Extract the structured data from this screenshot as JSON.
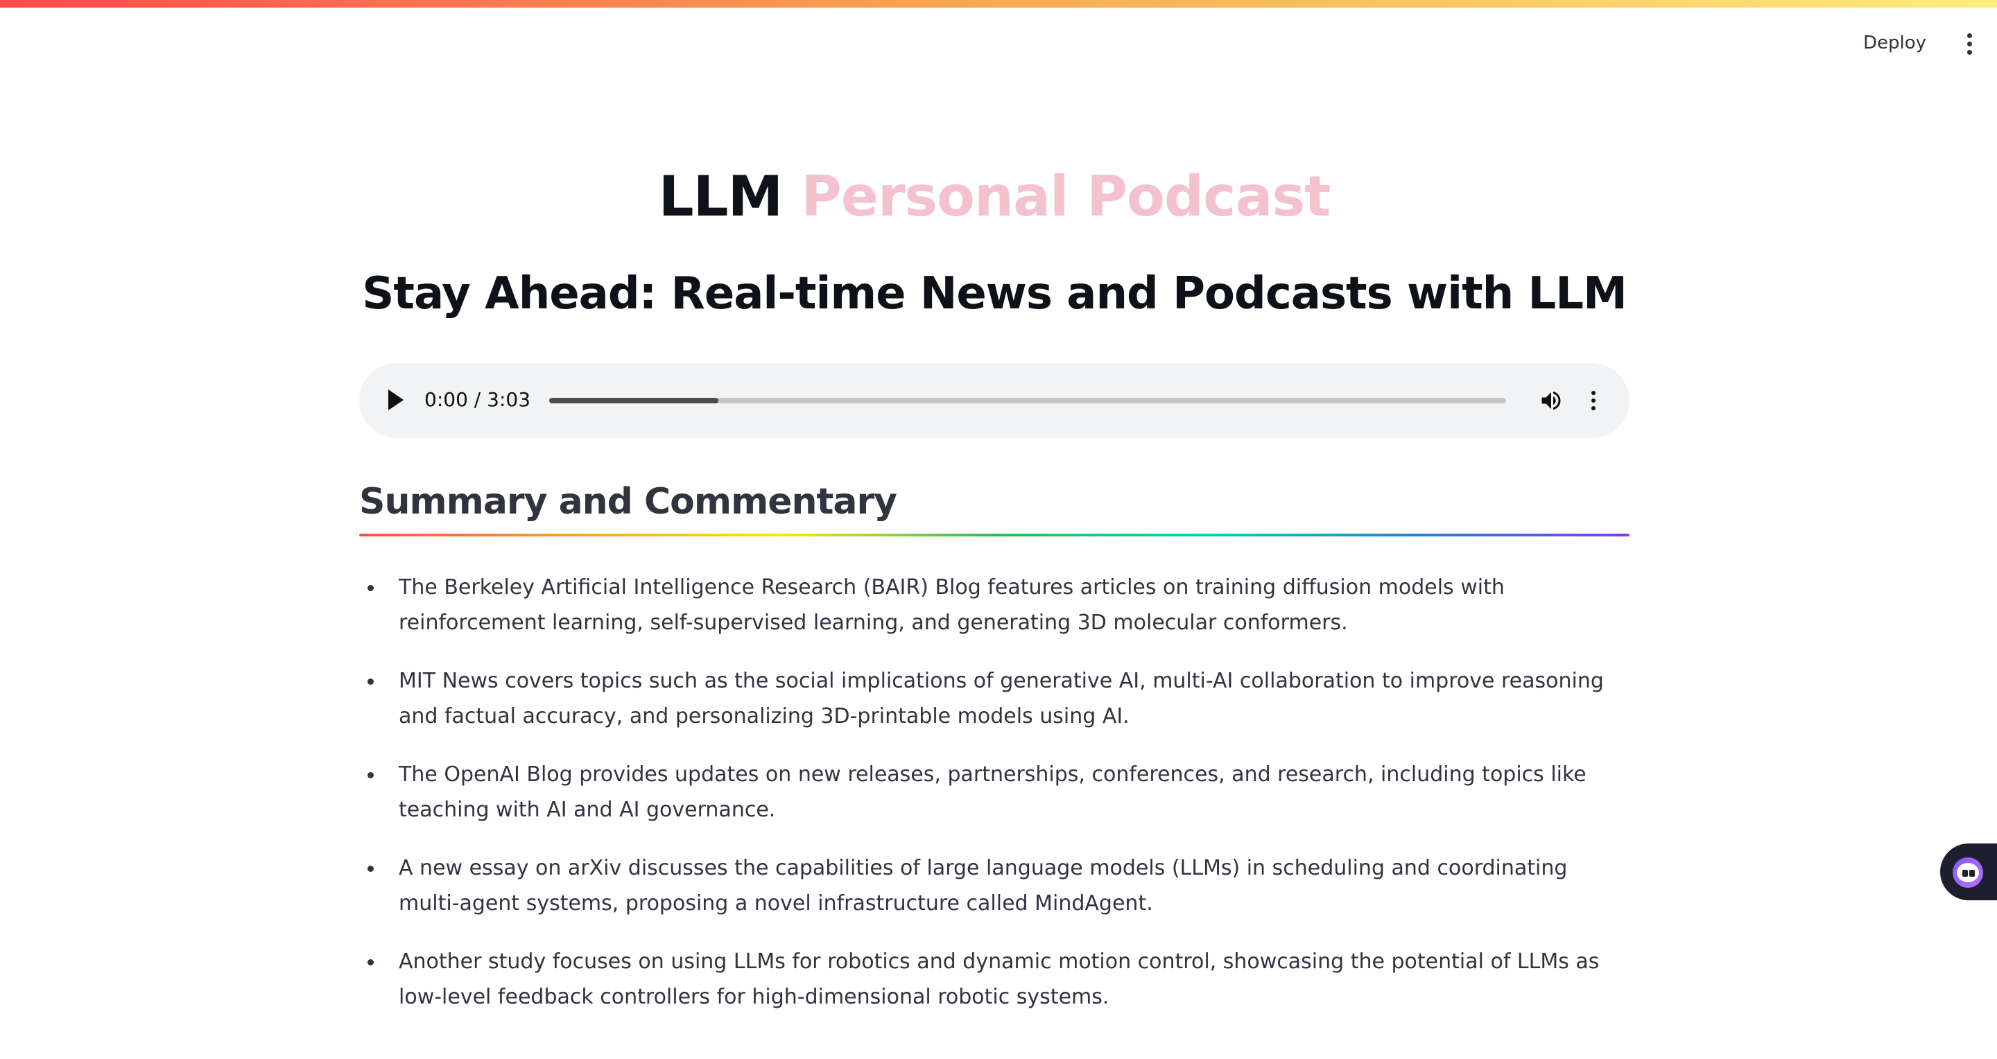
{
  "header": {
    "deploy_label": "Deploy",
    "menu_icon": "kebab-menu-icon"
  },
  "title": {
    "part1": "LLM",
    "part2": "Personal Podcast",
    "part2_color": "#f4c2cf"
  },
  "subtitle": "Stay Ahead: Real-time News and Podcasts with LLM",
  "audio": {
    "current_time": "0:00",
    "separator": "/",
    "duration": "3:03",
    "buffered_fraction": 0.177,
    "play_icon": "play-icon",
    "volume_icon": "volume-icon",
    "options_icon": "kebab-menu-icon"
  },
  "section": {
    "title": "Summary and Commentary"
  },
  "summary_items": [
    "The Berkeley Artificial Intelligence Research (BAIR) Blog features articles on training diffusion models with reinforcement learning, self-supervised learning, and generating 3D molecular conformers.",
    "MIT News covers topics such as the social implications of generative AI, multi-AI collaboration to improve reasoning and factual accuracy, and personalizing 3D-printable models using AI.",
    "The OpenAI Blog provides updates on new releases, partnerships, conferences, and research, including topics like teaching with AI and AI governance.",
    "A new essay on arXiv discusses the capabilities of large language models (LLMs) in scheduling and coordinating multi-agent systems, proposing a novel infrastructure called MindAgent.",
    "Another study focuses on using LLMs for robotics and dynamic motion control, showcasing the potential of LLMs as low-level feedback controllers for high-dimensional robotic systems."
  ],
  "widget": {
    "icon": "assistant-bot-icon"
  },
  "colors": {
    "accent": "#ff4b4b",
    "text": "#31333f",
    "player_bg": "#f1f3f4"
  }
}
